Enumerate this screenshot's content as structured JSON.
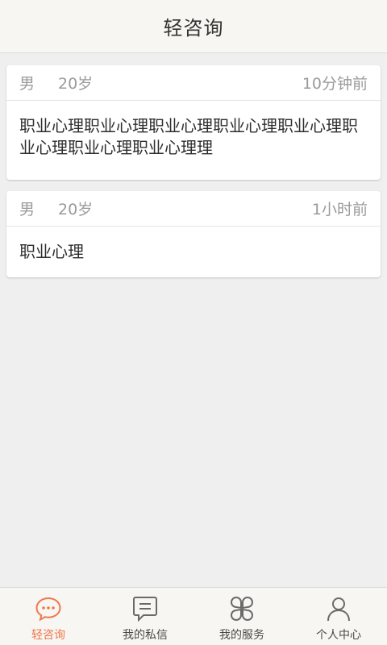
{
  "header": {
    "title": "轻咨询"
  },
  "consultations": [
    {
      "gender": "男",
      "age": "20岁",
      "time": "10分钟前",
      "content": "职业心理职业心理职业心理职业心理职业心理职业心理职业心理职业心理理"
    },
    {
      "gender": "男",
      "age": "20岁",
      "time": "1小时前",
      "content": "职业心理"
    }
  ],
  "tabbar": {
    "active_color": "#f0774d",
    "icon_color": "#6a6a6a",
    "tabs": [
      {
        "label": "轻咨询",
        "icon": "chat-bubble-icon",
        "active": true
      },
      {
        "label": "我的私信",
        "icon": "message-icon",
        "active": false
      },
      {
        "label": "我的服务",
        "icon": "service-grid-icon",
        "active": false
      },
      {
        "label": "个人中心",
        "icon": "person-icon",
        "active": false
      }
    ]
  }
}
